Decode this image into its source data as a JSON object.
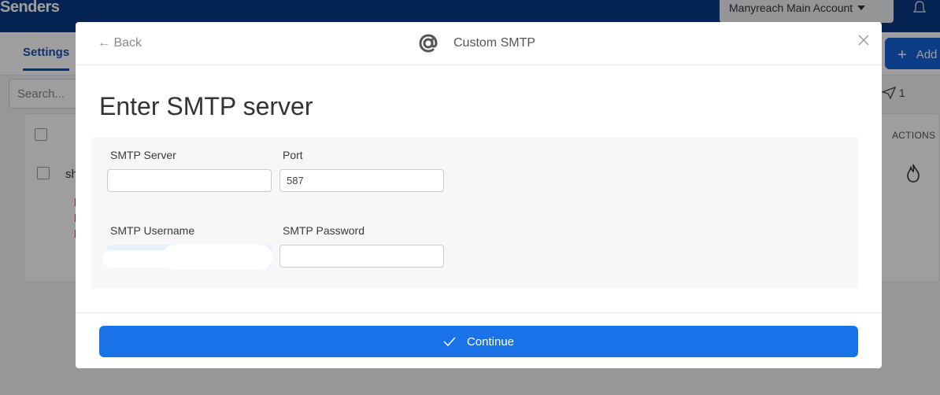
{
  "app": {
    "title": "Senders",
    "account_label": "Manyreach Main Account",
    "settings_tab": "Settings",
    "add_button": "Add",
    "search_placeholder": "Search...",
    "toolbar_count": "1",
    "actions_header": "ACTIONS",
    "row_text": "sh"
  },
  "modal": {
    "back_label": "← Back",
    "title": "Custom SMTP",
    "heading": "Enter SMTP server",
    "fields": {
      "server_label": "SMTP Server",
      "server_value": "",
      "port_label": "Port",
      "port_value": "587",
      "username_label": "SMTP Username",
      "password_label": "SMTP Password",
      "password_value": ""
    },
    "continue_label": "Continue"
  },
  "colors": {
    "primary": "#1a72e8",
    "topbar": "#0b3a86",
    "accent_tab": "#1a4fb0"
  },
  "icons": [
    "bell-icon",
    "at-sign-icon",
    "close-icon",
    "check-icon",
    "send-icon",
    "flame-icon",
    "caret-down-icon",
    "plus-icon"
  ]
}
